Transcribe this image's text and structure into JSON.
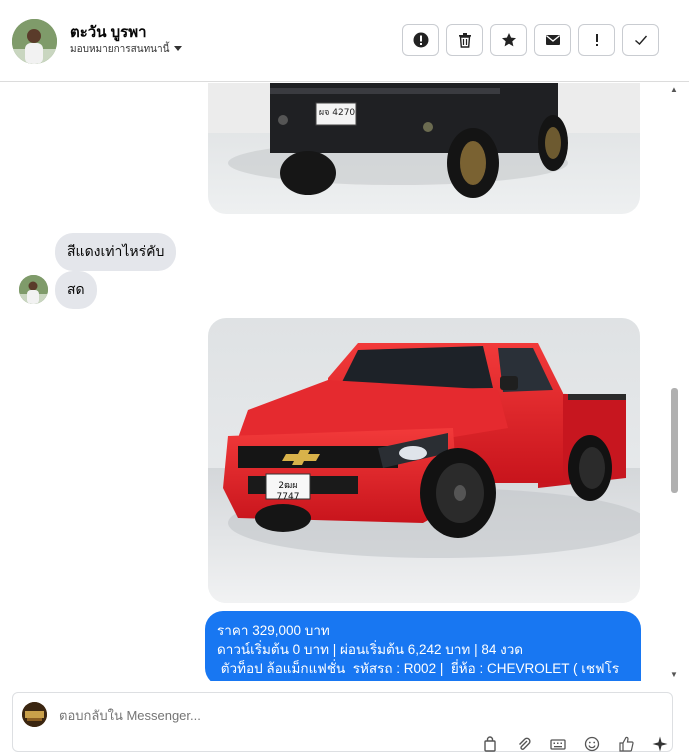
{
  "header": {
    "contact_name": "ตะวัน บูรพา",
    "assign_label": "มอบหมายการสนทนานี้"
  },
  "messages": {
    "in_1": "สีแดงเท่าไหร่คับ",
    "in_2": "สด",
    "out_line_1": "ราคา 329,000 บาท",
    "out_line_2": "ดาวน์เริ่มต้น 0 บาท | ผ่อนเริ่มต้น 6,242 บาท | 84 งวด",
    "out_line_3": " ตัวท็อป ล้อแม็กแฟชั่น  รหัสรถ : R002 |  ยี่ห้อ : CHEVROLET ( เชฟโร"
  },
  "plates": {
    "top_car": "ผจ 4270",
    "red_car": "2ฒผ 7747"
  },
  "composer": {
    "placeholder": "ตอบกลับใน Messenger..."
  },
  "icons": {
    "header_actions": [
      "alert-circle-icon",
      "trash-icon",
      "star-icon",
      "mail-icon",
      "exclamation-icon",
      "check-icon"
    ],
    "composer_tools": [
      "shopping-bag-icon",
      "paperclip-icon",
      "keyboard-icon",
      "emoji-icon",
      "thumbs-up-icon",
      "sparkle-icon"
    ]
  },
  "colors": {
    "brand_blue": "#1877f2",
    "bubble_gray": "#e4e6eb",
    "car_red": "#e21d25"
  }
}
